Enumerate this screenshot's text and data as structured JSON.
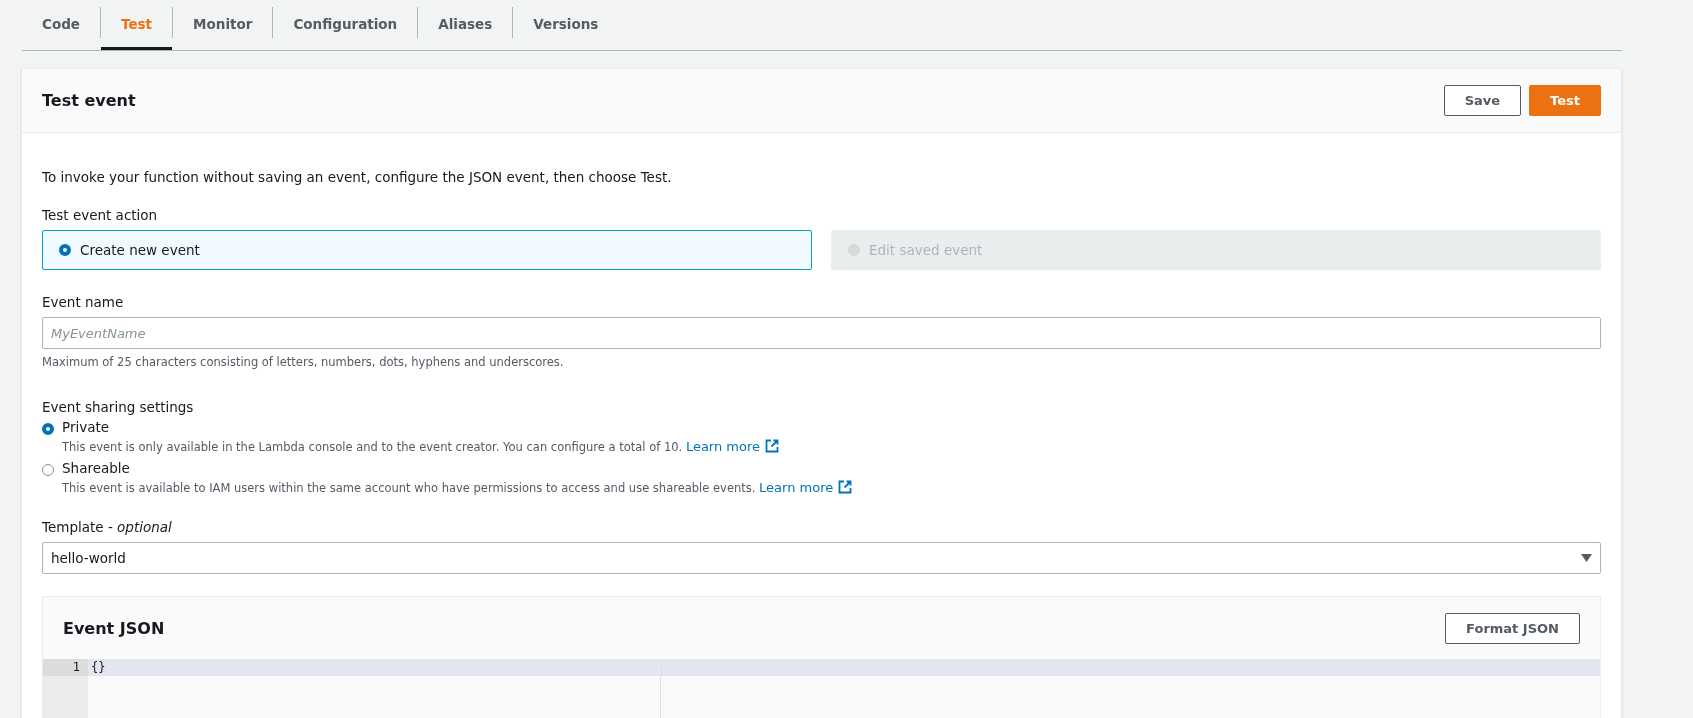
{
  "tabs": [
    {
      "label": "Code",
      "selected": false
    },
    {
      "label": "Test",
      "selected": true
    },
    {
      "label": "Monitor",
      "selected": false
    },
    {
      "label": "Configuration",
      "selected": false
    },
    {
      "label": "Aliases",
      "selected": false
    },
    {
      "label": "Versions",
      "selected": false
    }
  ],
  "panel": {
    "title": "Test event",
    "buttons": [
      {
        "label": "Save",
        "kind": "secondary"
      },
      {
        "label": "Test",
        "kind": "primary"
      }
    ],
    "intro": "To invoke your function without saving an event, configure the JSON event, then choose Test.",
    "action": {
      "label": "Test event action",
      "options": [
        {
          "label": "Create new event",
          "selected": true,
          "disabled": false
        },
        {
          "label": "Edit saved event",
          "selected": false,
          "disabled": true
        }
      ]
    },
    "event_name": {
      "label": "Event name",
      "placeholder": "MyEventName",
      "hint": "Maximum of 25 characters consisting of letters, numbers, dots, hyphens and underscores."
    },
    "sharing": {
      "label": "Event sharing settings",
      "options": [
        {
          "label": "Private",
          "selected": true,
          "description": "This event is only available in the Lambda console and to the event creator. You can configure a total of 10.",
          "link": "Learn more"
        },
        {
          "label": "Shareable",
          "selected": false,
          "description": "This event is available to IAM users within the same account who have permissions to access and use shareable events.",
          "link": "Learn more"
        }
      ]
    },
    "template": {
      "label": "Template - *optional*",
      "value": "hello-world"
    },
    "event_json": {
      "title": "Event JSON",
      "button": "Format JSON",
      "lines": [
        {
          "number": "1",
          "text": "{}",
          "selected": true
        }
      ]
    }
  }
}
